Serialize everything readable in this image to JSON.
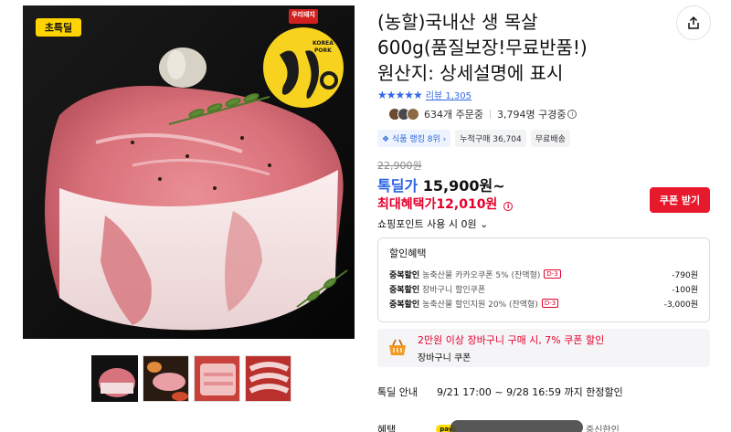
{
  "product": {
    "title_line1": "(농할)국내산 생 목살",
    "title_line2": "600g(품질보장!무료반품!)",
    "title_line3": "원산지: 상세설명에 표시",
    "image_badge": "초특딜",
    "brand_logo_tag": "우리돼지",
    "brand_logo_name": "한돈",
    "brand_logo_sub1": "KOREA",
    "brand_logo_sub2": "PORK"
  },
  "rating": {
    "stars": 5,
    "star_glyphs": "★★★★★",
    "review_label": "리뷰 1,305"
  },
  "social": {
    "orders": "634개 주문중",
    "viewers": "3,794명 구경중"
  },
  "tags": [
    "식품 랭킹 8위",
    "누적구매 36,704",
    "무료배송"
  ],
  "price": {
    "original": "22,900원",
    "deal_label": "톡딜가",
    "deal_value": "15,900원~",
    "max_label": "최대혜택가",
    "max_value": "12,010원",
    "coupon_button": "쿠폰 받기",
    "point_text": "쇼핑포인트 사용 시 0원"
  },
  "discounts": {
    "title": "할인혜택",
    "items": [
      {
        "kind": "중복할인",
        "name": "농축산물 카카오쿠폰 5% (잔액형)",
        "d_tag": "D-3",
        "amount": "-790원"
      },
      {
        "kind": "중복할인",
        "name": "장바구니 할인쿠폰",
        "d_tag": "",
        "amount": "-100원"
      },
      {
        "kind": "중복할인",
        "name": "농축산물 할인지원 20% (잔액형)",
        "d_tag": "D-3",
        "amount": "-3,000원"
      }
    ]
  },
  "cart_coupon": {
    "line1": "2만원 이상 장바구니 구매 시, 7% 쿠폰 할인",
    "line2": "장바구니 쿠폰"
  },
  "deal_info": {
    "label": "톡딜 안내",
    "value": "9/21 17:00 ~ 9/28 16:59 까지 한정할인"
  },
  "benefit": {
    "label": "혜택",
    "pay_badge": "pay",
    "tail": "중신한인"
  },
  "colors": {
    "accent_blue": "#2a62e4",
    "accent_red": "#e4002b",
    "coupon_red": "#e8192c"
  }
}
